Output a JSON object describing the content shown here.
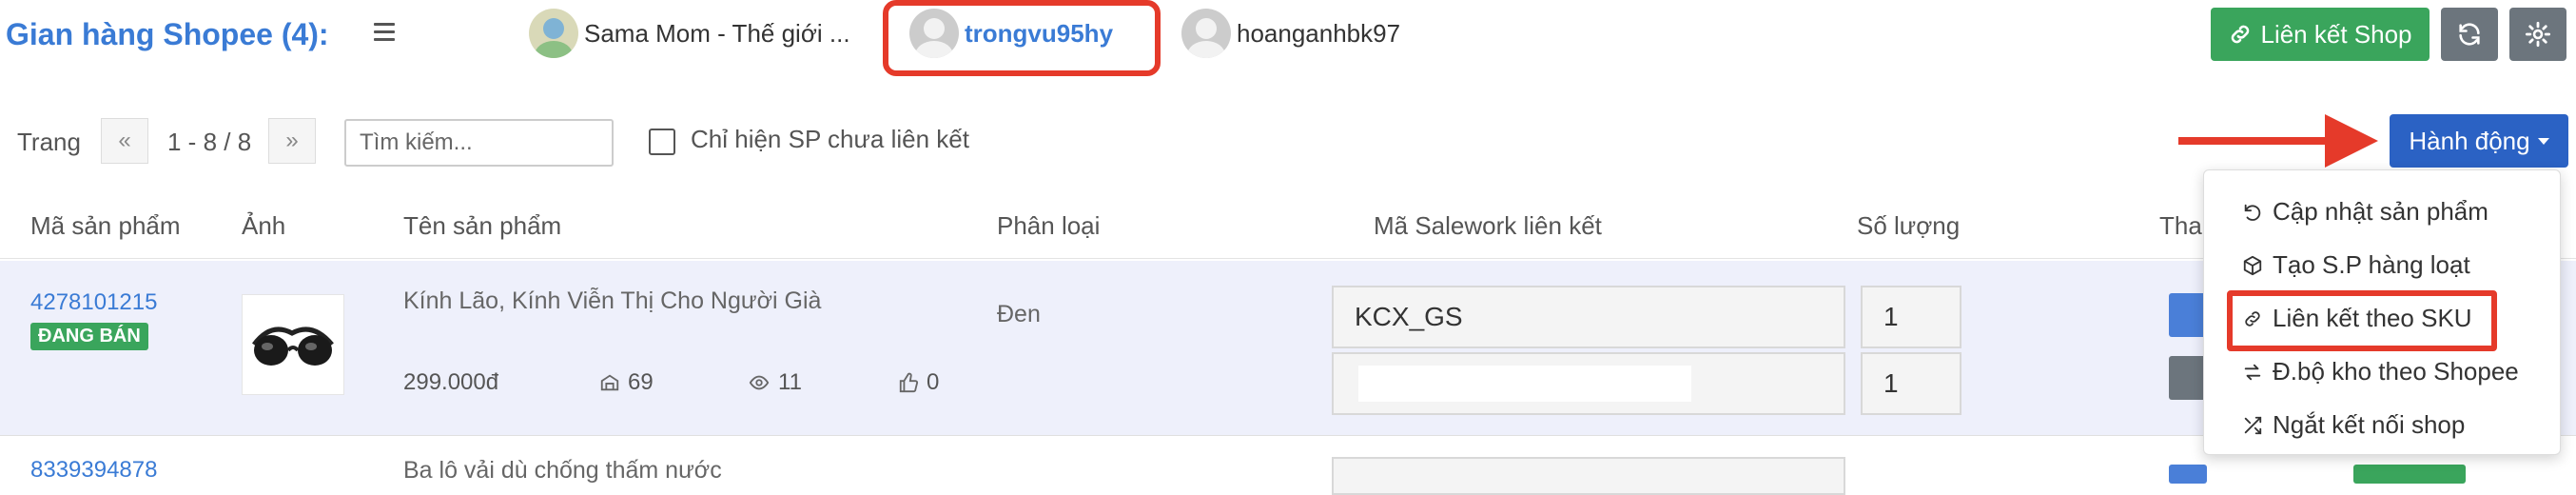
{
  "header": {
    "title": "Gian hàng Shopee (4):",
    "shops": [
      {
        "name": "Sama Mom - Thế giới ..."
      },
      {
        "name": "trongvu95hy",
        "active": true
      },
      {
        "name": "hoanganhbk97"
      }
    ],
    "link_shop_label": "Liên kết Shop",
    "refresh_icon": "refresh-icon",
    "settings_icon": "gear-icon"
  },
  "toolbar": {
    "page_label": "Trang",
    "range": "1 - 8 / 8",
    "search_placeholder": "Tìm kiếm...",
    "only_unlinked_label": "Chỉ hiện SP chưa liên kết",
    "actions_label": "Hành động"
  },
  "table": {
    "headers": [
      "Mã sản phẩm",
      "Ảnh",
      "Tên sản phẩm",
      "Phân loại",
      "Mã Salework liên kết",
      "Số lượng",
      "Tha"
    ],
    "rows": [
      {
        "sku": "4278101215",
        "status": "ĐANG BÁN",
        "name": "Kính Lão, Kính Viễn Thị Cho Người Già",
        "price": "299.000đ",
        "stock": "69",
        "views": "11",
        "likes": "0",
        "variant": "Đen",
        "salework_code": "KCX_GS",
        "qty1": "1",
        "qty2": "1"
      },
      {
        "sku": "8339394878",
        "name": "Ba lô vải dù chống thấm nước"
      }
    ]
  },
  "actions_menu": {
    "items": [
      {
        "label": "Cập nhật sản phẩm",
        "icon": "undo-icon"
      },
      {
        "label": "Tạo S.P hàng loạt",
        "icon": "box-icon"
      },
      {
        "label": "Liên kết theo SKU",
        "icon": "link-icon"
      },
      {
        "label": "Đ.bộ kho theo Shopee",
        "icon": "sync-icon"
      },
      {
        "label": "Ngắt kết nối shop",
        "icon": "shuffle-icon"
      }
    ]
  },
  "colors": {
    "accent": "#3a7bd5",
    "green": "#3aa55c",
    "action_blue": "#2b62c4",
    "highlight_red": "#e53a2a",
    "row_bg": "#eef0fb"
  }
}
